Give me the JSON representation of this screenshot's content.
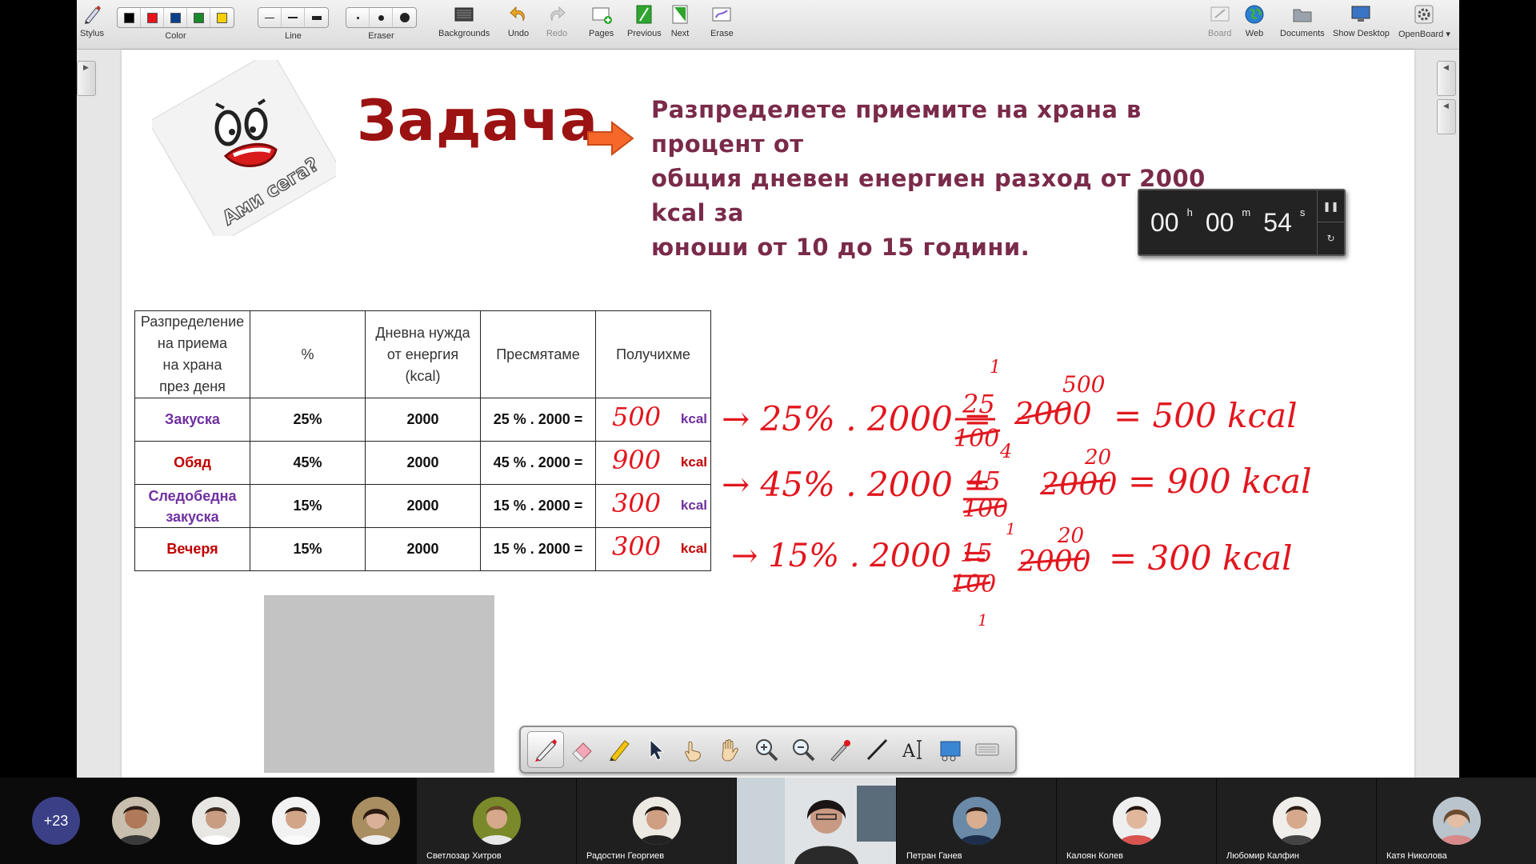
{
  "toolbar": {
    "left": [
      {
        "name": "stylus",
        "label": "Stylus",
        "icon": "stylus-icon"
      },
      {
        "name": "color",
        "label": "Color"
      },
      {
        "name": "line",
        "label": "Line"
      },
      {
        "name": "eraser",
        "label": "Eraser"
      },
      {
        "name": "backgrounds",
        "label": "Backgrounds",
        "icon": "backgrounds-icon"
      },
      {
        "name": "undo",
        "label": "Undo",
        "icon": "undo-icon"
      },
      {
        "name": "redo",
        "label": "Redo",
        "icon": "redo-icon"
      },
      {
        "name": "pages",
        "label": "Pages",
        "icon": "pages-icon"
      },
      {
        "name": "previous",
        "label": "Previous",
        "icon": "previous-icon"
      },
      {
        "name": "next",
        "label": "Next",
        "icon": "next-icon"
      },
      {
        "name": "erase",
        "label": "Erase",
        "icon": "erase-icon"
      }
    ],
    "right": [
      {
        "name": "board",
        "label": "Board",
        "icon": "board-icon"
      },
      {
        "name": "web",
        "label": "Web",
        "icon": "globe-icon"
      },
      {
        "name": "documents",
        "label": "Documents",
        "icon": "folder-icon"
      },
      {
        "name": "show-desktop",
        "label": "Show Desktop",
        "icon": "monitor-icon"
      },
      {
        "name": "openboard",
        "label": "OpenBoard",
        "icon": "gear-icon"
      }
    ],
    "colors": [
      "#000000",
      "#e8141b",
      "#0a3f8c",
      "#17892b",
      "#f5d100"
    ]
  },
  "slide": {
    "sticker_text": "Ами сега?",
    "title": "Задача",
    "task_lines": [
      "Разпределете приемите на храна в процент от",
      "общия дневен енергиен разход от 2000 kcal за",
      "юноши от 10 до 15 години."
    ],
    "timer": {
      "hours": "00",
      "h": "h",
      "minutes": "00",
      "m": "m",
      "seconds": "54",
      "s": "s"
    },
    "table": {
      "headers": [
        "Разпределение на приема на храна през деня",
        "%",
        "Дневна нужда от енергия (kcal)",
        "Пресмятаме",
        "Получихме"
      ],
      "header_lines": [
        [
          "Разпределение",
          "на приема",
          "на храна",
          "през деня"
        ],
        [
          "%"
        ],
        [
          "Дневна нужда",
          "от енергия",
          "(kcal)"
        ],
        [
          "Пресмятаме"
        ],
        [
          "Получихме"
        ]
      ],
      "rows": [
        {
          "meal": "Закуска",
          "meal_color": "#7030a0",
          "percent": "25%",
          "energy": "2000",
          "calc": "25 % . 2000 =",
          "result": "500",
          "unit": "kcal",
          "unit_color": "#7030a0"
        },
        {
          "meal": "Обяд",
          "meal_color": "#c00000",
          "percent": "45%",
          "energy": "2000",
          "calc": "45 % . 2000 =",
          "result": "900",
          "unit": "kcal",
          "unit_color": "#c00000"
        },
        {
          "meal": "Следобедна закуска",
          "meal_lines": [
            "Следобедна",
            "закуска"
          ],
          "meal_color": "#7030a0",
          "percent": "15%",
          "energy": "2000",
          "calc": "15 % . 2000 =",
          "result": "300",
          "unit": "kcal",
          "unit_color": "#7030a0"
        },
        {
          "meal": "Вечеря",
          "meal_color": "#c00000",
          "percent": "15%",
          "energy": "2000",
          "calc": "15 % . 2000 =",
          "result": "300",
          "unit": "kcal",
          "unit_color": "#c00000"
        }
      ]
    },
    "handwriting": {
      "color": "#e2161e",
      "lines": [
        {
          "lhs": "→ 25% . 2000 =",
          "num": "25",
          "den": "100",
          "top": "1",
          "sub": "4",
          "mult": "2000",
          "mult_top": "500",
          "rhs": "= 500 kcal"
        },
        {
          "lhs": "→ 45% . 2000 =",
          "num": "45",
          "den": "100",
          "mult": "2000",
          "mult_top": "20",
          "rhs": "= 900 kcal"
        },
        {
          "lhs": "→ 15% . 2000 =",
          "num": "15",
          "den": "100",
          "top": "1",
          "sub": "1",
          "mult": "2000",
          "mult_top": "20",
          "rhs": "= 300 kcal"
        }
      ]
    }
  },
  "palette": [
    "pen-icon",
    "eraser-icon",
    "highlighter-icon",
    "pointer-icon",
    "play-icon",
    "hand-icon",
    "zoom-in-icon",
    "zoom-out-icon",
    "laser-pointer-icon",
    "line-icon",
    "text-icon",
    "capture-icon",
    "keyboard-icon"
  ],
  "meeting": {
    "more_count": "+23",
    "named": [
      {
        "name": "Светлозар Хитров"
      },
      {
        "name": "Радостин Георгиев"
      },
      {
        "name": ""
      },
      {
        "name": "Петран Ганев"
      },
      {
        "name": "Калоян Колев"
      },
      {
        "name": "Любомир Калфин"
      },
      {
        "name": "Катя Николова"
      }
    ]
  }
}
